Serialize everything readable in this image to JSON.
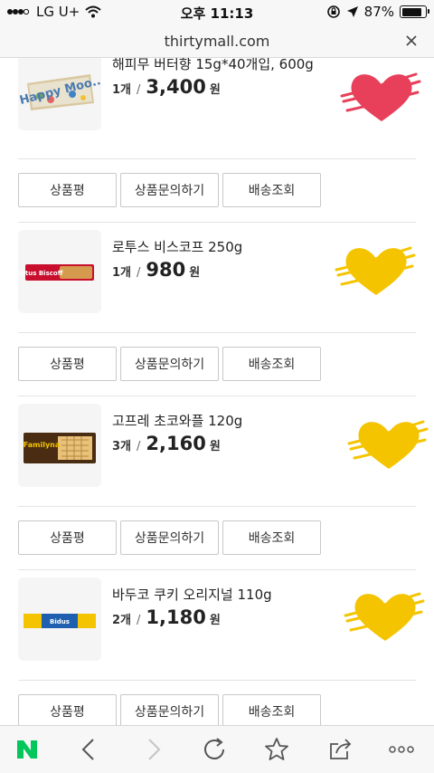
{
  "status_bar": {
    "carrier": "LG U+",
    "time": "오후 11:13",
    "battery_percent": "87%",
    "battery_level": 0.87
  },
  "browser": {
    "url": "thirtymall.com",
    "close_icon": "close-icon"
  },
  "products": [
    {
      "name": "해피무 버터향 15g*40개입, 600g",
      "qty": "1개",
      "price": "3,400",
      "unit": "원",
      "heart_color": "#e8405a",
      "thumb_label": "Happy Moo.."
    },
    {
      "name": "로투스 비스코프 250g",
      "qty": "1개",
      "price": "980",
      "unit": "원",
      "heart_color": "#f5c400",
      "thumb_label": "Lotus Biscoff"
    },
    {
      "name": "고프레 초코와플 120g",
      "qty": "3개",
      "price": "2,160",
      "unit": "원",
      "heart_color": "#f5c400",
      "thumb_label": "Familyna"
    },
    {
      "name": "바두코 쿠키 오리지널 110g",
      "qty": "2개",
      "price": "1,180",
      "unit": "원",
      "heart_color": "#f5c400",
      "thumb_label": "Bidus"
    }
  ],
  "actions": {
    "review": "상품평",
    "inquiry": "상품문의하기",
    "shipping": "배송조회"
  },
  "toolbar_icons": [
    "naver-icon",
    "back-icon",
    "forward-icon",
    "reload-icon",
    "bookmark-icon",
    "share-icon",
    "more-icon"
  ],
  "colors": {
    "accent_green": "#03c75a",
    "divider": "#e4e4e4"
  }
}
